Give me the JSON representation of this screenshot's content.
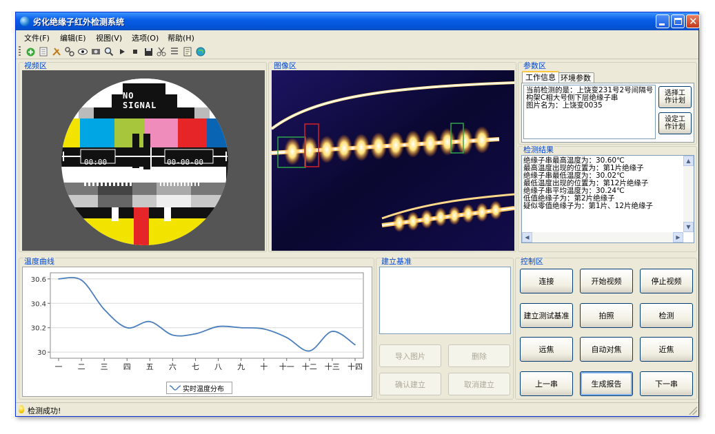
{
  "window": {
    "title": "劣化绝缘子红外检测系统"
  },
  "menu": [
    "文件(F)",
    "编辑(E)",
    "视图(V)",
    "选项(O)",
    "帮助(H)"
  ],
  "toolbar_icons": [
    "add-icon",
    "document-icon",
    "tools-icon",
    "link-icon",
    "eye-icon",
    "record-icon",
    "zoom-icon",
    "play-icon",
    "stop-icon",
    "save-icon",
    "scissors-icon",
    "settings-icon",
    "notes-icon",
    "globe-icon"
  ],
  "panels": {
    "video": {
      "label": "视频区",
      "no_signal": "NO SIGNAL",
      "time_left": "00:00",
      "time_right": "00-00-00"
    },
    "image": {
      "label": "图像区"
    },
    "params": {
      "label": "参数区",
      "tabs": [
        "工作信息",
        "环境参数"
      ],
      "info_lines": [
        "当前检测的是：上饶变231号2号间隔号",
        "构架C相大号侧下层绝缘子串",
        "图片名为：上饶变0035"
      ],
      "select_plan": "选择工作计划",
      "set_plan": "设定工作计划"
    },
    "results": {
      "label": "检测结果",
      "lines": [
        "绝缘子串最高温度为：30.60℃",
        "最高温度出现的位置为：第1片绝缘子",
        "绝缘子串最低温度为：30.02℃",
        "最低温度出现的位置为：第12片绝缘子",
        "绝缘子串平均温度为：30.24℃",
        "低值绝缘子为：第2片绝缘子",
        "疑似零值绝缘子为：第1片、12片绝缘子"
      ]
    },
    "temp_curve": {
      "label": "温度曲线"
    },
    "baseline": {
      "label": "建立基准",
      "import": "导入图片",
      "delete": "删除",
      "confirm": "确认建立",
      "cancel": "取消建立"
    },
    "control": {
      "label": "控制区",
      "buttons": [
        [
          "连接",
          "开始视频",
          "停止视频"
        ],
        [
          "建立测试基准",
          "拍照",
          "检测"
        ],
        [
          "远焦",
          "自动对焦",
          "近焦"
        ],
        [
          "上一串",
          "生成报告",
          "下一串"
        ]
      ]
    }
  },
  "chart_data": {
    "type": "line",
    "categories": [
      "一",
      "二",
      "三",
      "四",
      "五",
      "六",
      "七",
      "八",
      "九",
      "十",
      "十一",
      "十二",
      "十三",
      "十四"
    ],
    "series": [
      {
        "name": "实时温度分布",
        "values": [
          30.6,
          30.59,
          30.35,
          30.2,
          30.25,
          30.14,
          30.15,
          30.21,
          30.2,
          30.19,
          30.12,
          30.01,
          30.17,
          30.06
        ],
        "color": "#4a7ebb"
      }
    ],
    "yticks": [
      30,
      30.2,
      30.4,
      30.6
    ],
    "ylim": [
      29.95,
      30.65
    ],
    "grid": true,
    "legend": "bottom-center"
  },
  "status": {
    "text": "检测成功!"
  }
}
